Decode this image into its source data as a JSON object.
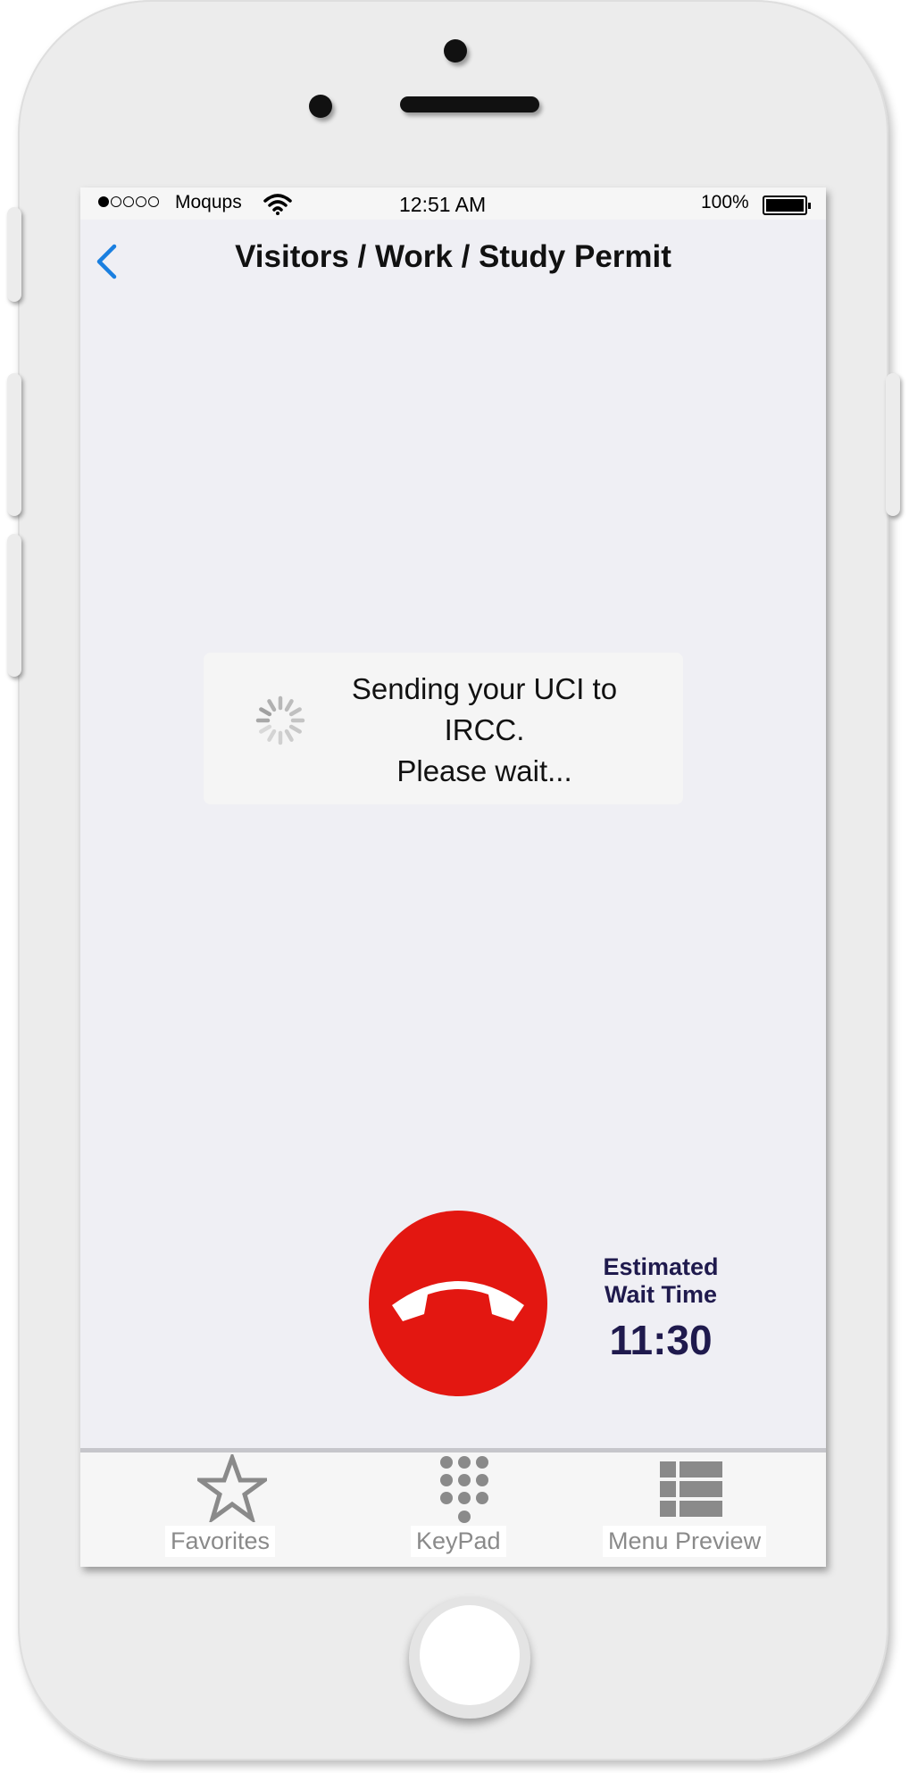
{
  "status_bar": {
    "carrier": "Moqups",
    "time": "12:51 AM",
    "battery": "100%"
  },
  "nav": {
    "title": "Visitors / Work / Study Permit"
  },
  "loading": {
    "line1": "Sending your UCI to",
    "line2": "IRCC.",
    "line3": "Please wait..."
  },
  "call": {
    "wait_label_line1": "Estimated",
    "wait_label_line2": "Wait Time",
    "wait_time": "11:30"
  },
  "tabs": [
    {
      "label": "Favorites",
      "icon": "star-icon"
    },
    {
      "label": "KeyPad",
      "icon": "keypad-icon"
    },
    {
      "label": "Menu Preview",
      "icon": "list-icon"
    }
  ],
  "colors": {
    "hangup": "#e31711",
    "wait_text": "#1f1a4d",
    "back_arrow": "#1a7fe0",
    "tab_icon": "#8a8a8a"
  }
}
